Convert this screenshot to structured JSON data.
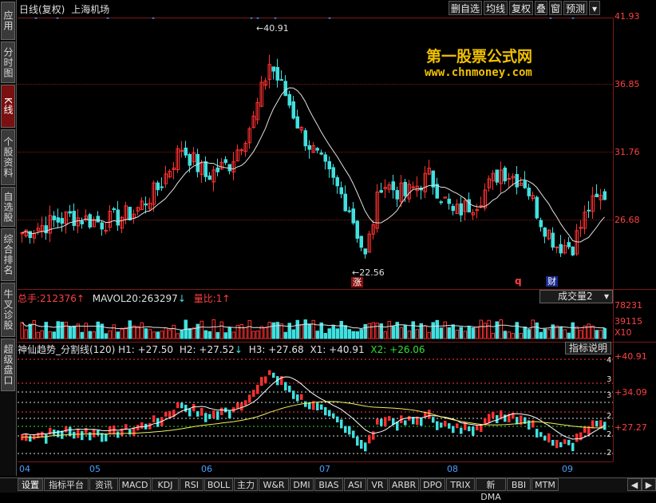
{
  "sidebar": {
    "tabs": [
      {
        "label": "应用",
        "active": false
      },
      {
        "label": "分时图",
        "active": false
      },
      {
        "label": "K线",
        "active": true
      },
      {
        "label": "个股资料",
        "active": false
      },
      {
        "label": "自选股",
        "active": false
      },
      {
        "label": "综合排名",
        "active": false
      },
      {
        "label": "牛叉诊股",
        "active": false
      },
      {
        "label": "超级盘口",
        "active": false
      }
    ]
  },
  "header": {
    "period": "日线(复权)",
    "stock_name": "上海机场"
  },
  "toolbar": {
    "buttons": [
      "删自选",
      "均线",
      "复权",
      "叠",
      "窗",
      "预测"
    ]
  },
  "watermark": {
    "line1": "第一股票公式网",
    "line2": "www.chnmoney.com"
  },
  "price_axis": [
    "41.93",
    "36.85",
    "31.76",
    "26.68"
  ],
  "markers": {
    "high": "40.91",
    "low": "22.56",
    "zhang": "涨",
    "q": "q",
    "cai": "财"
  },
  "volume": {
    "total_label": "总手:",
    "total_value": "212376",
    "ma_label": "MAVOL20:",
    "ma_value": "263297",
    "ratio_label": "量比:",
    "ratio_value": "1",
    "selector": "成交量2",
    "axis": [
      "78231",
      "39115",
      "X10"
    ]
  },
  "indicator": {
    "name": "神仙趋势_分割线(120)",
    "h1": "H1: +27.50",
    "h2": "H2: +27.52",
    "h3": "H3: +27.68",
    "x1": "X1: +40.91",
    "x2": "X2: +26.06",
    "help_button": "指标说明",
    "axis": [
      "+40.91",
      "+34.09",
      "+27.27"
    ],
    "right_ticks": [
      "4",
      "3",
      "3",
      "2",
      "2",
      "2"
    ]
  },
  "time_axis": [
    "04",
    "05",
    "06",
    "07",
    "08",
    "09"
  ],
  "bottom_tabs": [
    "设置",
    "指标平台",
    "资讯",
    "MACD",
    "KDJ",
    "RSI",
    "BOLL",
    "主力",
    "W&R",
    "DMI",
    "BIAS",
    "ASI",
    "VR",
    "ARBR",
    "DPO",
    "TRIX",
    "新DMA",
    "BBI",
    "MTM"
  ],
  "colors": {
    "up": "#ff3030",
    "down": "#40e0e0",
    "ma": "#ffffff",
    "axis": "#ff4040",
    "gold": "#f0c000"
  }
}
